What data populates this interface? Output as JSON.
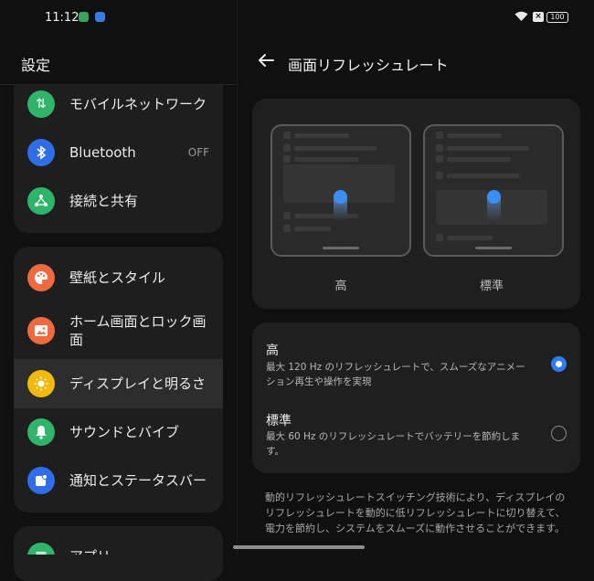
{
  "status_bar": {
    "time": "11:12",
    "battery": "100"
  },
  "left_pane": {
    "title": "設定",
    "group1": [
      {
        "label": "モバイルネットワーク",
        "icon": "mobile-network-icon",
        "color": "#2fb46a"
      },
      {
        "label": "Bluetooth",
        "value": "OFF",
        "icon": "bluetooth-icon",
        "color": "#2f6ee6"
      },
      {
        "label": "接続と共有",
        "icon": "connection-sharing-icon",
        "color": "#2fb46a"
      }
    ],
    "group2": [
      {
        "label": "壁紙とスタイル",
        "icon": "palette-icon",
        "color": "#ef6a3e"
      },
      {
        "label_line1": "ホーム画面とロック画",
        "label_line2": "面",
        "icon": "image-icon",
        "color": "#ef6a3e"
      },
      {
        "label": "ディスプレイと明るさ",
        "icon": "brightness-icon",
        "color": "#f2b90d",
        "active": true
      },
      {
        "label": "サウンドとバイブ",
        "icon": "bell-icon",
        "color": "#2fb46a"
      },
      {
        "label": "通知とステータスバー",
        "icon": "notification-icon",
        "color": "#2f6ee6"
      }
    ],
    "group3_partial_label": "アプリ"
  },
  "right_pane": {
    "title": "画面リフレッシュレート",
    "previews": [
      {
        "label": "高"
      },
      {
        "label": "標準"
      }
    ],
    "options": [
      {
        "title": "高",
        "desc": "最大 120 Hz のリフレッシュレートで、スムーズなアニメーション再生や操作を実現",
        "selected": true
      },
      {
        "title": "標準",
        "desc": "最大 60 Hz のリフレッシュレートでバッテリーを節約します。",
        "selected": false
      }
    ],
    "footnote": "動的リフレッシュレートスイッチング技術により、ディスプレイのリフレッシュレートを動的に低リフレッシュレートに切り替えて、電力を節約し、システムをスムーズに動作させることができます。"
  },
  "colors": {
    "accent": "#2f7cf6",
    "background": "#101010",
    "card": "#1e1e1e"
  }
}
